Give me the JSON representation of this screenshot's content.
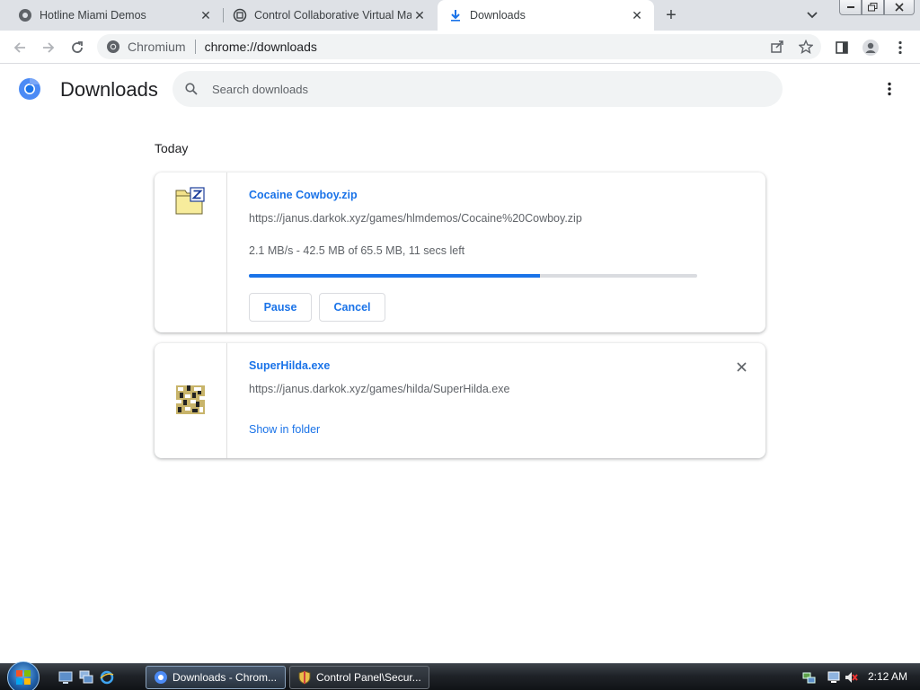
{
  "tabs": [
    {
      "label": "Hotline Miami Demos",
      "icon": "chromium-globe-icon"
    },
    {
      "label": "Control Collaborative Virtual Mac",
      "icon": "vm-icon"
    },
    {
      "label": "Downloads",
      "icon": "download-icon",
      "active": true
    }
  ],
  "omnibox": {
    "site": "Chromium",
    "url": "chrome://downloads"
  },
  "header": {
    "title": "Downloads",
    "search_placeholder": "Search downloads"
  },
  "section": {
    "date": "Today"
  },
  "downloads": [
    {
      "filename": "Cocaine Cowboy.zip",
      "url": "https://janus.darkok.xyz/games/hlmdemos/Cocaine%20Cowboy.zip",
      "status": "2.1 MB/s - 42.5 MB of 65.5 MB, 11 secs left",
      "progress": 0.649,
      "pause_label": "Pause",
      "cancel_label": "Cancel"
    },
    {
      "filename": "SuperHilda.exe",
      "url": "https://janus.darkok.xyz/games/hilda/SuperHilda.exe",
      "action_label": "Show in folder"
    }
  ],
  "taskbar": {
    "tasks": [
      {
        "label": "Downloads - Chrom...",
        "active": true
      },
      {
        "label": "Control Panel\\Secur...",
        "active": false
      }
    ],
    "clock": "2:12 AM"
  },
  "colors": {
    "accent": "#1a73e8",
    "progress_track": "#dadce0"
  }
}
